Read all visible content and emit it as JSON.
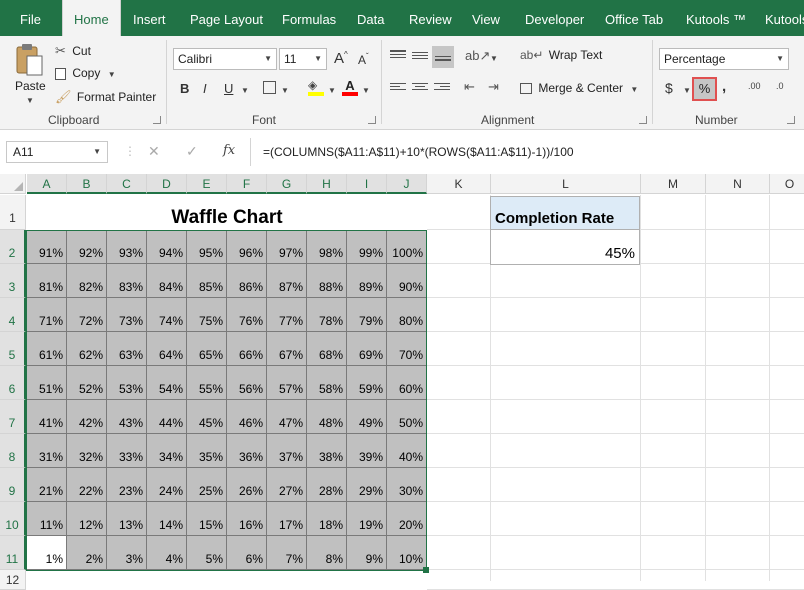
{
  "tabs": [
    "File",
    "Home",
    "Insert",
    "Page Layout",
    "Formulas",
    "Data",
    "Review",
    "View",
    "Developer",
    "Office Tab",
    "Kutools ™",
    "Kutools"
  ],
  "clipboard": {
    "paste": "Paste",
    "cut": "Cut",
    "copy": "Copy",
    "format_painter": "Format Painter",
    "label": "Clipboard"
  },
  "font": {
    "name": "Calibri",
    "size": "11",
    "label": "Font",
    "bold": "B",
    "italic": "I",
    "underline": "U",
    "grow": "A",
    "shrink": "A"
  },
  "alignment": {
    "wrap": "Wrap Text",
    "merge": "Merge & Center",
    "label": "Alignment"
  },
  "number": {
    "format": "Percentage",
    "label": "Number",
    "currency": "$",
    "percent": "%",
    "comma": ",",
    "inc_dec": ".00",
    "dec_dec": ".0"
  },
  "formula_bar": {
    "name_box": "A11",
    "fx": "fx",
    "formula": "=(COLUMNS($A11:A$11)+10*(ROWS($A11:A$11)-1))/100"
  },
  "columns": [
    "A",
    "B",
    "C",
    "D",
    "E",
    "F",
    "G",
    "H",
    "I",
    "J",
    "K",
    "L",
    "M",
    "N",
    "O"
  ],
  "rows": [
    "1",
    "2",
    "3",
    "4",
    "5",
    "6",
    "7",
    "8",
    "9",
    "10",
    "11",
    "12"
  ],
  "title": "Waffle Chart",
  "completion_label": "Completion Rate",
  "completion_value": "45%",
  "grid": [
    [
      "91%",
      "92%",
      "93%",
      "94%",
      "95%",
      "96%",
      "97%",
      "98%",
      "99%",
      "100%"
    ],
    [
      "81%",
      "82%",
      "83%",
      "84%",
      "85%",
      "86%",
      "87%",
      "88%",
      "89%",
      "90%"
    ],
    [
      "71%",
      "72%",
      "73%",
      "74%",
      "75%",
      "76%",
      "77%",
      "78%",
      "79%",
      "80%"
    ],
    [
      "61%",
      "62%",
      "63%",
      "64%",
      "65%",
      "66%",
      "67%",
      "68%",
      "69%",
      "70%"
    ],
    [
      "51%",
      "52%",
      "53%",
      "54%",
      "55%",
      "56%",
      "57%",
      "58%",
      "59%",
      "60%"
    ],
    [
      "41%",
      "42%",
      "43%",
      "44%",
      "45%",
      "46%",
      "47%",
      "48%",
      "49%",
      "50%"
    ],
    [
      "31%",
      "32%",
      "33%",
      "34%",
      "35%",
      "36%",
      "37%",
      "38%",
      "39%",
      "40%"
    ],
    [
      "21%",
      "22%",
      "23%",
      "24%",
      "25%",
      "26%",
      "27%",
      "28%",
      "29%",
      "30%"
    ],
    [
      "11%",
      "12%",
      "13%",
      "14%",
      "15%",
      "16%",
      "17%",
      "18%",
      "19%",
      "20%"
    ],
    [
      "1%",
      "2%",
      "3%",
      "4%",
      "5%",
      "6%",
      "7%",
      "8%",
      "9%",
      "10%"
    ]
  ],
  "colors": {
    "excel_green": "#217346",
    "cell_gray": "#c0c0c0",
    "header_blue": "#ddebf7",
    "highlight_red": "#e05050"
  }
}
